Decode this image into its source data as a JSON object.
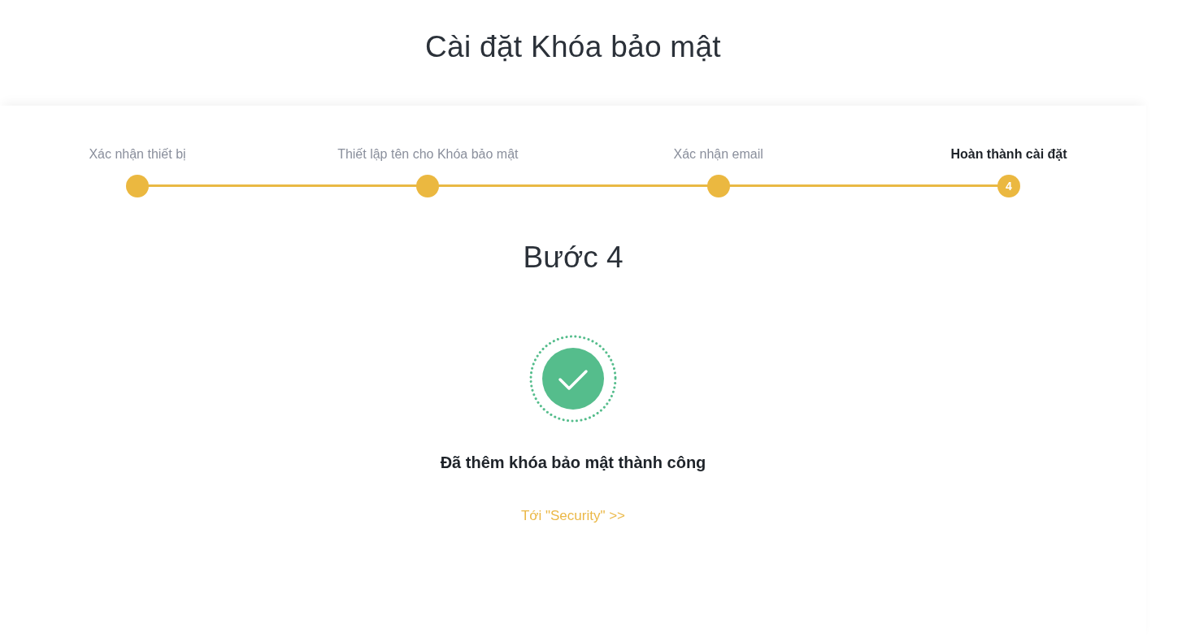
{
  "page": {
    "title": "Cài đặt Khóa bảo mật"
  },
  "stepper": {
    "steps": [
      {
        "label": "Xác nhận thiết bị",
        "selected": false
      },
      {
        "label": "Thiết lập tên cho Khóa bảo mật",
        "selected": false
      },
      {
        "label": "Xác nhận email",
        "selected": false
      },
      {
        "label": "Hoàn thành cài đặt",
        "selected": true,
        "number": "4"
      }
    ]
  },
  "result": {
    "heading": "Bước 4",
    "kind": "success",
    "message": "Đã thêm khóa bảo mật thành công",
    "link": "Tới \"Security\" >>"
  }
}
